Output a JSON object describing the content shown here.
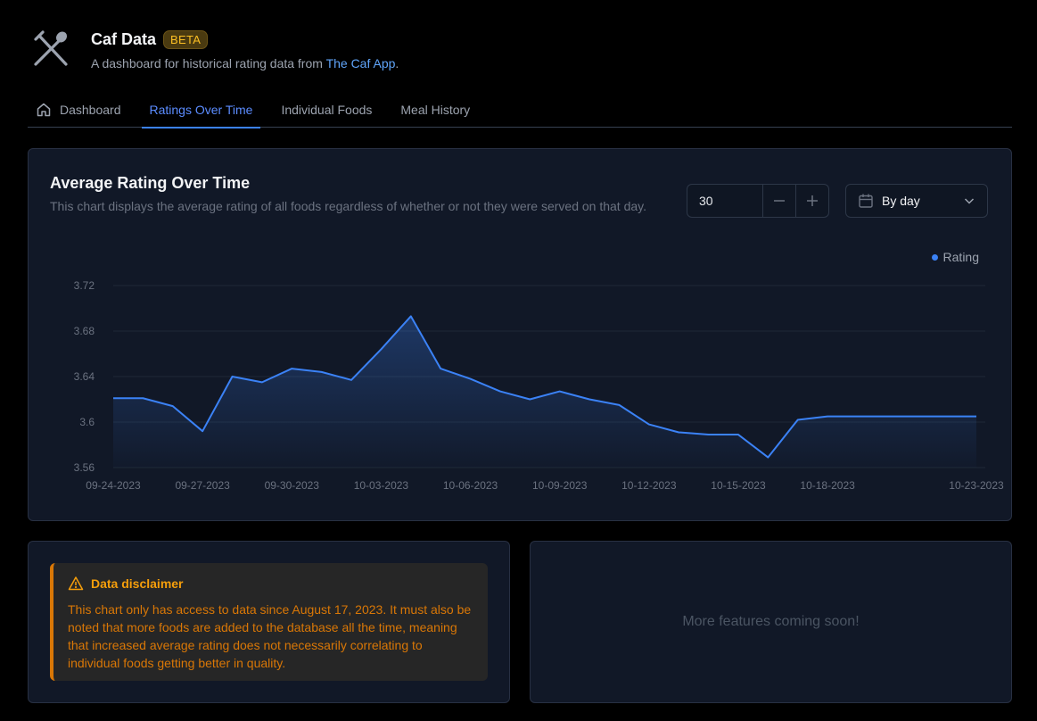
{
  "app": {
    "title": "Caf Data",
    "badge": "BETA",
    "subtitle_prefix": "A dashboard for historical rating data from ",
    "subtitle_link": "The Caf App",
    "subtitle_suffix": ".",
    "logo_icon": "fork-spoon-icon"
  },
  "tabs": [
    {
      "label": "Dashboard",
      "icon": "home-icon",
      "active": false
    },
    {
      "label": "Ratings Over Time",
      "active": true
    },
    {
      "label": "Individual Foods",
      "active": false
    },
    {
      "label": "Meal History",
      "active": false
    }
  ],
  "chart_card": {
    "title": "Average Rating Over Time",
    "description": "This chart displays the average rating of all foods regardless of whether or not they were served on that day.",
    "stepper": {
      "value": "30",
      "minus": "−",
      "plus": "+"
    },
    "select": {
      "value": "By day",
      "icon": "calendar-icon"
    }
  },
  "chart_data": {
    "type": "area",
    "title": "",
    "xlabel": "",
    "ylabel": "",
    "ylim": [
      3.56,
      3.72
    ],
    "yticks": [
      "3.72",
      "3.68",
      "3.64",
      "3.6",
      "3.56"
    ],
    "xticks": [
      "09-24-2023",
      "09-27-2023",
      "09-30-2023",
      "10-03-2023",
      "10-06-2023",
      "10-09-2023",
      "10-12-2023",
      "10-15-2023",
      "10-18-2023",
      "10-23-2023"
    ],
    "grid": true,
    "legend": "top-right",
    "color": "#3b82f6",
    "series": [
      {
        "name": "Rating",
        "x": [
          "09-24-2023",
          "09-25-2023",
          "09-26-2023",
          "09-27-2023",
          "09-28-2023",
          "09-29-2023",
          "09-30-2023",
          "10-01-2023",
          "10-02-2023",
          "10-03-2023",
          "10-04-2023",
          "10-05-2023",
          "10-06-2023",
          "10-07-2023",
          "10-08-2023",
          "10-09-2023",
          "10-10-2023",
          "10-11-2023",
          "10-12-2023",
          "10-13-2023",
          "10-14-2023",
          "10-15-2023",
          "10-16-2023",
          "10-17-2023",
          "10-18-2023",
          "10-19-2023",
          "10-20-2023",
          "10-21-2023",
          "10-22-2023",
          "10-23-2023"
        ],
        "values": [
          3.621,
          3.621,
          3.614,
          3.592,
          3.64,
          3.635,
          3.647,
          3.644,
          3.637,
          3.664,
          3.693,
          3.647,
          3.638,
          3.627,
          3.62,
          3.627,
          3.62,
          3.615,
          3.598,
          3.591,
          3.589,
          3.589,
          3.569,
          3.602,
          3.605,
          3.605,
          3.605,
          3.605,
          3.605,
          3.605
        ]
      }
    ]
  },
  "disclaimer": {
    "title": "Data disclaimer",
    "icon": "warning-triangle-icon",
    "body": "This chart only has access to data since August 17, 2023. It must also be noted that more foods are added to the database all the time, meaning that increased average rating does not necessarily correlating to individual foods getting better in quality."
  },
  "coming_soon": {
    "text": "More features coming soon!"
  }
}
